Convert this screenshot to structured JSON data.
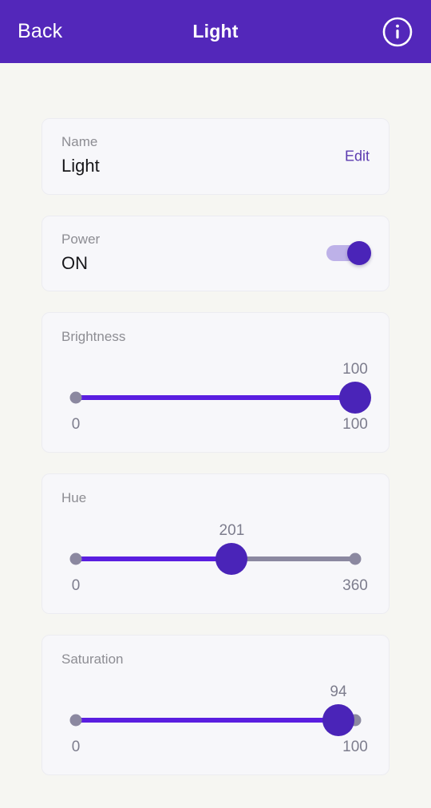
{
  "header": {
    "back_label": "Back",
    "title": "Light",
    "info_icon": "info-circle-icon",
    "background_color": "#5327ba",
    "text_color": "#ffffff"
  },
  "theme": {
    "accent": "#4a24b8",
    "track_fill": "#5a1ee0",
    "track_base": "#8b88a0",
    "page_background": "#f6f6f2",
    "card_background": "#f7f7fa",
    "label_color": "#8d8d93",
    "value_color": "#17171a",
    "link_color": "#5b3bb0"
  },
  "cards": {
    "name": {
      "label": "Name",
      "value": "Light",
      "action_label": "Edit"
    },
    "power": {
      "label": "Power",
      "value": "ON",
      "toggle_state": "on"
    }
  },
  "sliders": [
    {
      "title": "Brightness",
      "value": 100,
      "value_text": "100",
      "min": 0,
      "max": 100,
      "min_text": "0",
      "max_text": "100"
    },
    {
      "title": "Hue",
      "value": 201,
      "value_text": "201",
      "min": 0,
      "max": 360,
      "min_text": "0",
      "max_text": "360"
    },
    {
      "title": "Saturation",
      "value": 94,
      "value_text": "94",
      "min": 0,
      "max": 100,
      "min_text": "0",
      "max_text": "100"
    }
  ]
}
